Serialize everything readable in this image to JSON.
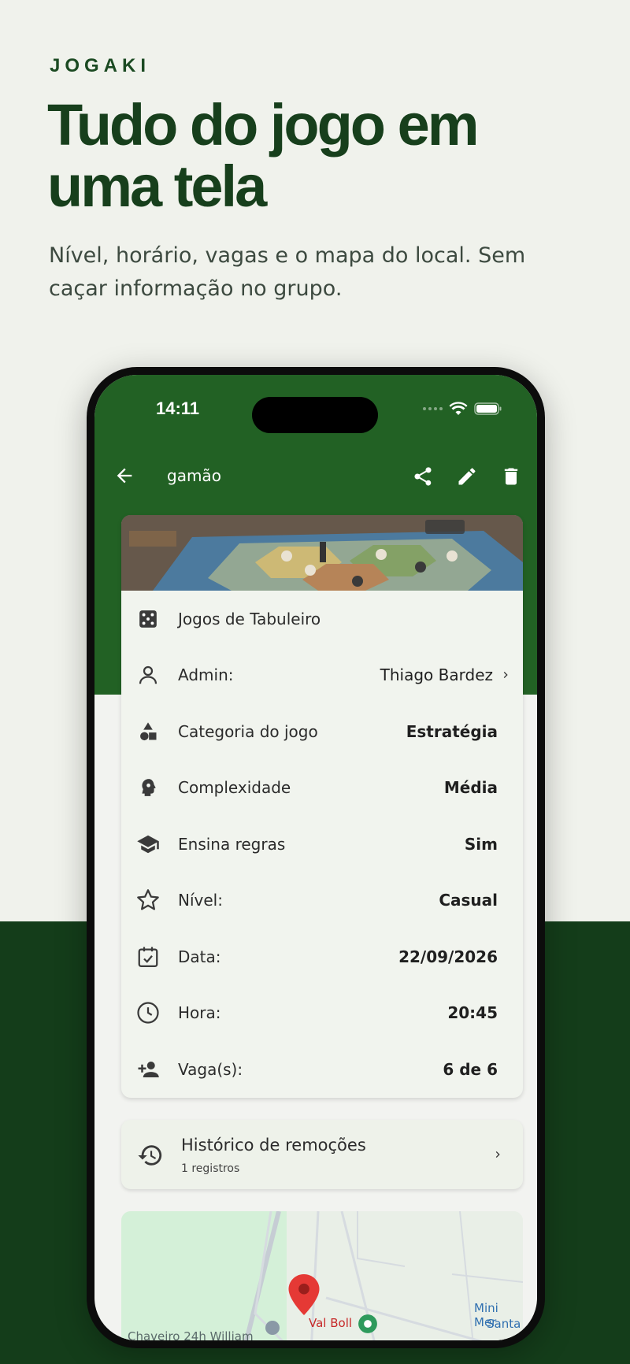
{
  "brand": "JOGAKI",
  "headline": "Tudo do jogo em uma tela",
  "subtitle": "Nível, horário, vagas e o mapa do local. Sem caçar informação no grupo.",
  "phone": {
    "status": {
      "time": "14:11"
    },
    "appbar": {
      "title": "gamão"
    },
    "details": {
      "rows": [
        {
          "icon": "dice-icon",
          "label": "Jogos de Tabuleiro",
          "value": ""
        },
        {
          "icon": "person-icon",
          "label": "Admin:",
          "value": "Thiago Bardez"
        },
        {
          "icon": "shapes-icon",
          "label": "Categoria do jogo",
          "value": "Estratégia"
        },
        {
          "icon": "brain-head-icon",
          "label": "Complexidade",
          "value": "Média"
        },
        {
          "icon": "graduation-cap-icon",
          "label": "Ensina regras",
          "value": "Sim"
        },
        {
          "icon": "star-icon",
          "label": "Nível:",
          "value": "Casual"
        },
        {
          "icon": "calendar-check-icon",
          "label": "Data:",
          "value": "22/09/2026"
        },
        {
          "icon": "clock-icon",
          "label": "Hora:",
          "value": "20:45"
        },
        {
          "icon": "person-add-icon",
          "label": "Vaga(s):",
          "value": "6 de 6"
        }
      ]
    },
    "history": {
      "title": "Histórico de remoções",
      "subtitle": "1 registros"
    },
    "map": {
      "labels": {
        "pin": "Val Boll",
        "left": "Chaveiro 24h William",
        "right_1": "Mini Mer",
        "right_2": "Santa"
      }
    }
  },
  "colors": {
    "primary": "#226124",
    "dark_band": "#143d1a",
    "background": "#f0f2ec",
    "pin": "#e53935"
  }
}
